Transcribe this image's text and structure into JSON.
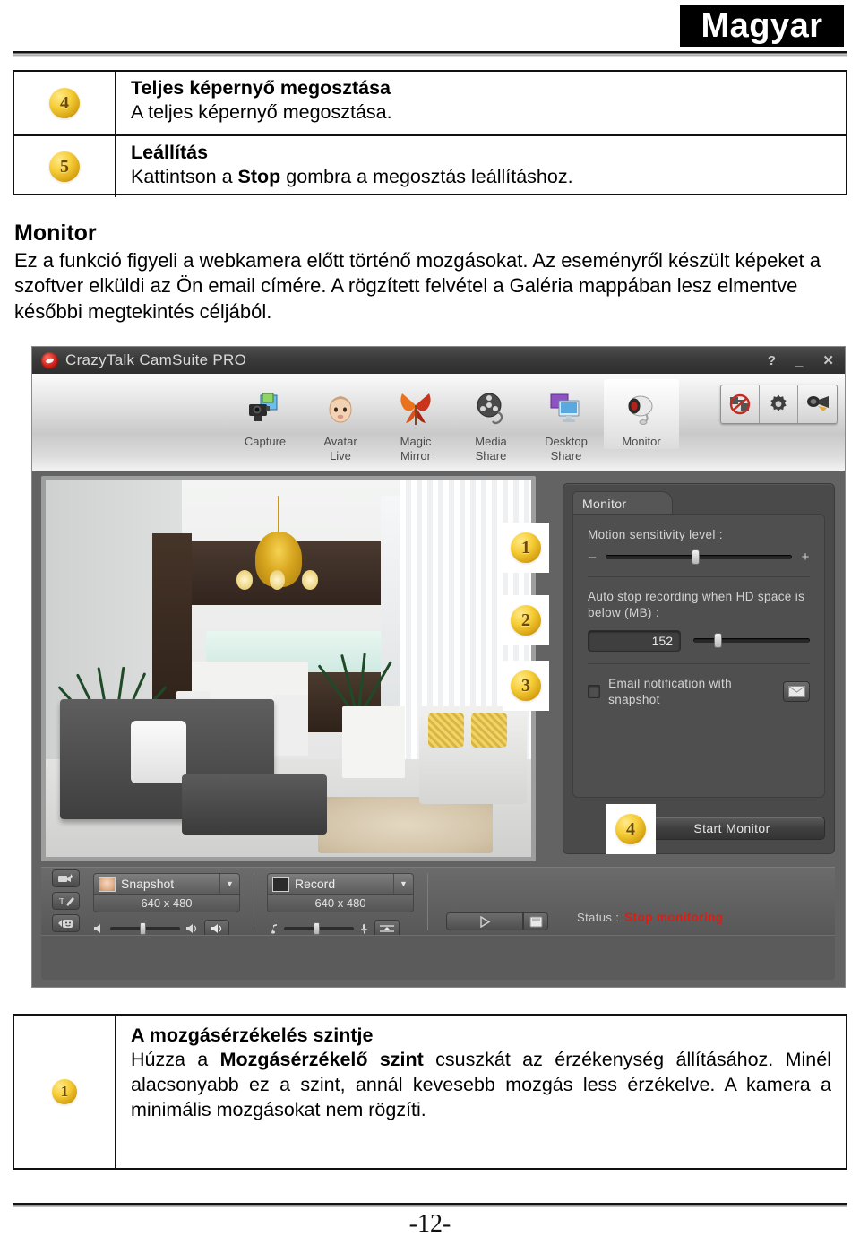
{
  "header": {
    "language_badge": "Magyar"
  },
  "top_table": {
    "rows": [
      {
        "num": "4",
        "title": "Teljes képernyő megosztása",
        "body_plain": "A teljes képernyő megosztása.",
        "body_html": "A teljes képernyő megosztása."
      },
      {
        "num": "5",
        "title": "Leállítás",
        "body_plain": "Kattintson a Stop gombra a megosztás leállításhoz.",
        "body_pre": "Kattintson a ",
        "body_bold": "Stop",
        "body_post": " gombra a megosztás leállításhoz."
      }
    ]
  },
  "section": {
    "heading": "Monitor",
    "paragraph": "Ez a funkció figyeli a webkamera előtt történő mozgásokat. Az eseményről készült képeket a szoftver elküldi az Ön email címére. A rögzített felvétel a Galéria mappában lesz elmentve későbbi megtekintés céljából."
  },
  "app": {
    "title": "CrazyTalk CamSuite PRO",
    "window_buttons": {
      "help": "?",
      "minimize": "_",
      "close": "✕"
    },
    "nav": [
      {
        "label_line1": "Capture",
        "label_line2": "",
        "icon": "camera-icon",
        "active": false
      },
      {
        "label_line1": "Avatar",
        "label_line2": "Live",
        "icon": "avatar-face-icon",
        "active": false
      },
      {
        "label_line1": "Magic",
        "label_line2": "Mirror",
        "icon": "mask-icon",
        "active": false
      },
      {
        "label_line1": "Media",
        "label_line2": "Share",
        "icon": "film-reel-icon",
        "active": false
      },
      {
        "label_line1": "Desktop",
        "label_line2": "Share",
        "icon": "monitor-share-icon",
        "active": false
      },
      {
        "label_line1": "Monitor",
        "label_line2": "",
        "icon": "webcam-icon",
        "active": true
      }
    ],
    "nav_right_icons": [
      "no-video-icon",
      "gear-icon",
      "camera-settings-icon"
    ],
    "panel": {
      "tab_label": "Monitor",
      "sensitivity_label": "Motion sensitivity level :",
      "slider_minus": "–",
      "slider_plus": "+",
      "sensitivity_value_pct": 46,
      "hd_label": "Auto stop recording when HD space is below (MB) :",
      "hd_value": "152",
      "hd_slider_pct": 18,
      "email_checkbox_label": "Email notification with snapshot",
      "email_checked": false,
      "mail_icon": "envelope-icon",
      "start_button": "Start Monitor"
    },
    "badges": [
      "1",
      "2",
      "3",
      "4"
    ],
    "toolbar": {
      "side_icons": [
        "video-effect-icon",
        "text-tool-icon",
        "emoticon-icon"
      ],
      "snapshot_label": "Snapshot",
      "snapshot_resolution": "640 x 480",
      "record_label": "Record",
      "record_resolution": "640 x 480",
      "dropdown_arrow": "▼",
      "speaker_icon": "speaker-icon",
      "speaker_low_icon": "speaker-low-icon",
      "mic_note_icon": "music-note-icon",
      "mic_icon": "microphone-icon",
      "mixer_icon": "mixer-icon",
      "play_icon": "play-icon",
      "gallery_icon": "gallery-folder-icon",
      "status_label": "Status :",
      "status_value": "Stop monitoring",
      "status_color": "#e01b10"
    }
  },
  "bottom_table": {
    "num": "1",
    "title": "A mozgásérzékelés szintje",
    "body_pre": "Húzza a ",
    "body_bold": "Mozgásérzékelő szint",
    "body_post": " csuszkát az érzékenység állításához. Minél alacsonyabb ez a szint, annál kevesebb mozgás less érzékelve. A kamera a minimális mozgásokat nem rögzíti."
  },
  "footer": {
    "page_number": "-12-"
  }
}
